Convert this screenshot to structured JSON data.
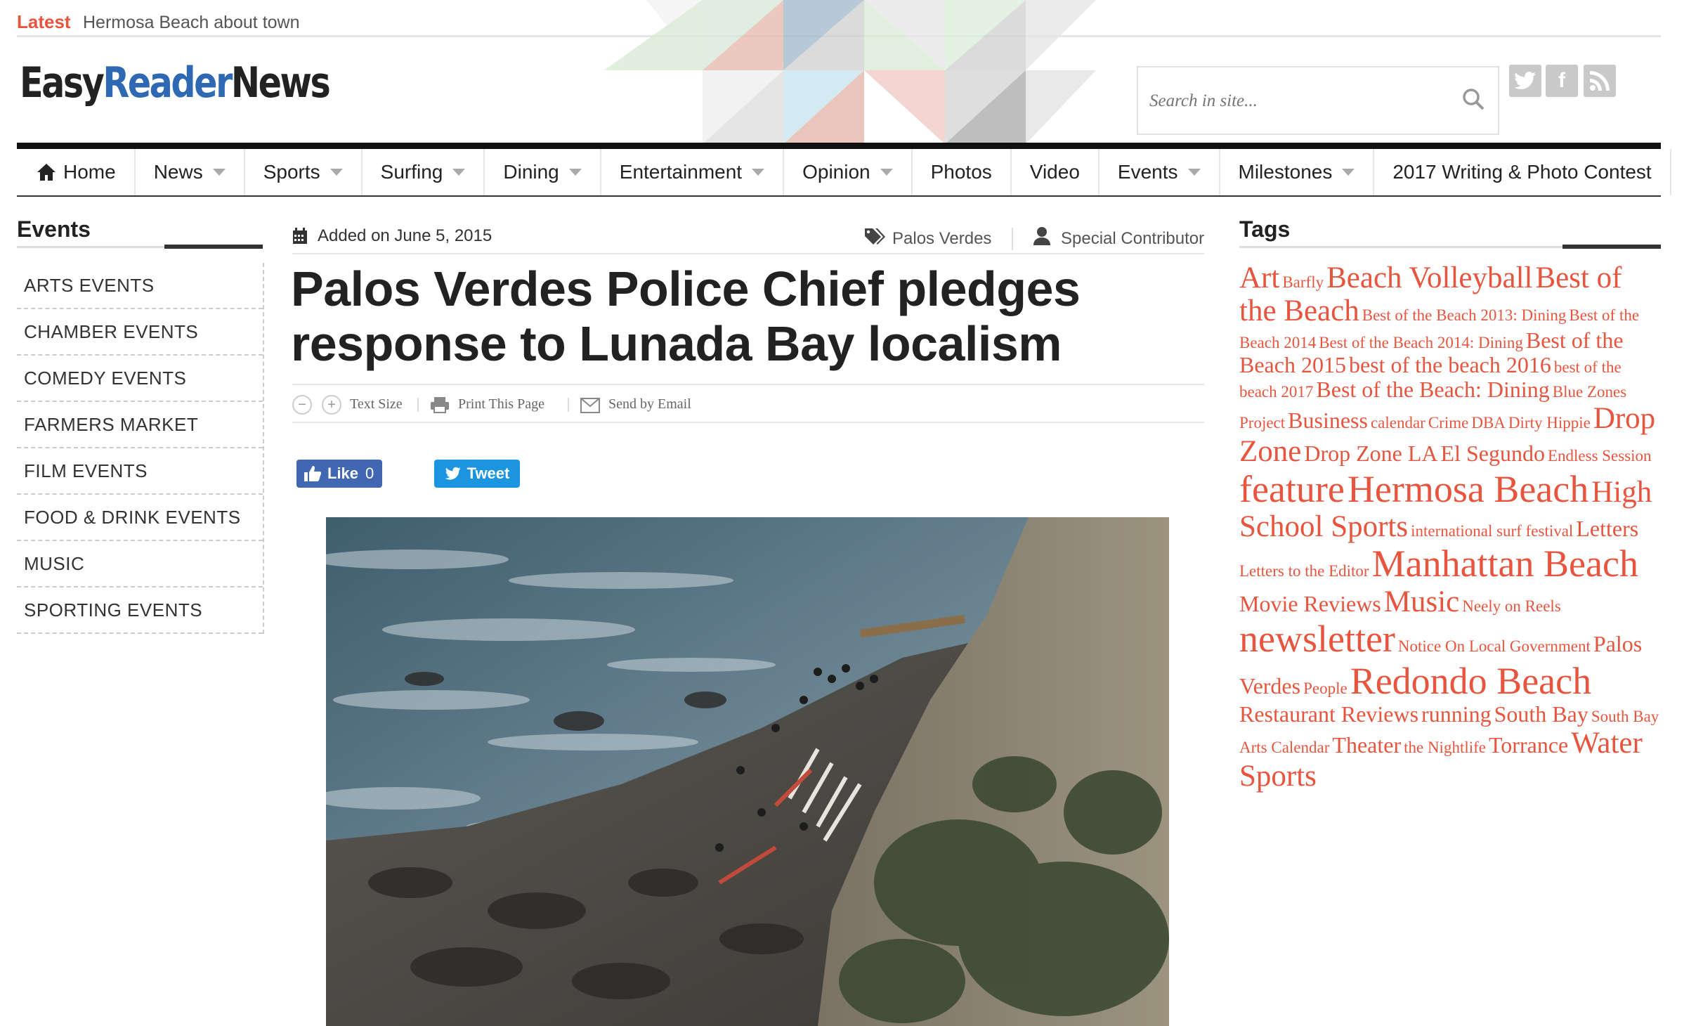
{
  "latest": {
    "label": "Latest",
    "headline": "Hermosa Beach about town"
  },
  "logo": {
    "part1": "Easy",
    "part2": "Reader",
    "part3": "News"
  },
  "search": {
    "placeholder": "Search in site..."
  },
  "social": [
    "twitter-icon",
    "facebook-icon",
    "rss-icon"
  ],
  "nav": {
    "items": [
      {
        "label": "Home",
        "icon": "home-icon",
        "dropdown": false
      },
      {
        "label": "News",
        "dropdown": true
      },
      {
        "label": "Sports",
        "dropdown": true
      },
      {
        "label": "Surfing",
        "dropdown": true
      },
      {
        "label": "Dining",
        "dropdown": true
      },
      {
        "label": "Entertainment",
        "dropdown": true
      },
      {
        "label": "Opinion",
        "dropdown": true
      },
      {
        "label": "Photos",
        "dropdown": false
      },
      {
        "label": "Video",
        "dropdown": false
      },
      {
        "label": "Events",
        "dropdown": true
      },
      {
        "label": "Milestones",
        "dropdown": true
      },
      {
        "label": "2017 Writing & Photo Contest",
        "dropdown": false
      }
    ]
  },
  "sidebar": {
    "title": "Events",
    "items": [
      "ARTS EVENTS",
      "CHAMBER EVENTS",
      "COMEDY EVENTS",
      "FARMERS MARKET",
      "FILM EVENTS",
      "FOOD & DRINK EVENTS",
      "MUSIC",
      "SPORTING EVENTS"
    ]
  },
  "article": {
    "date": "Added on June 5, 2015",
    "category": "Palos Verdes",
    "author": "Special Contributor",
    "headline": "Palos Verdes Police Chief pledges response to Lunada Bay localism",
    "tools": {
      "text_size": "Text Size",
      "print": "Print This Page",
      "email": "Send by Email"
    },
    "like": {
      "label": "Like",
      "count": "0"
    },
    "tweet": "Tweet"
  },
  "tags": {
    "title": "Tags",
    "items": [
      {
        "t": "Art",
        "s": 3
      },
      {
        "t": "Barfly",
        "s": 1
      },
      {
        "t": "Beach Volleyball",
        "s": 3
      },
      {
        "t": "Best of the Beach",
        "s": 3
      },
      {
        "t": "Best of the Beach 2013: Dining",
        "s": 1
      },
      {
        "t": "Best of the Beach 2014",
        "s": 1
      },
      {
        "t": "Best of the Beach 2014: Dining",
        "s": 1
      },
      {
        "t": "Best of the Beach 2015",
        "s": 2
      },
      {
        "t": "best of the beach 2016",
        "s": 2
      },
      {
        "t": "best of the beach 2017",
        "s": 1
      },
      {
        "t": "Best of the Beach: Dining",
        "s": 2
      },
      {
        "t": "Blue Zones Project",
        "s": 1
      },
      {
        "t": "Business",
        "s": 2
      },
      {
        "t": "calendar",
        "s": 1
      },
      {
        "t": "Crime",
        "s": 1
      },
      {
        "t": "DBA",
        "s": 1
      },
      {
        "t": "Dirty Hippie",
        "s": 1
      },
      {
        "t": "Drop Zone",
        "s": 3
      },
      {
        "t": "Drop Zone LA",
        "s": 2
      },
      {
        "t": "El Segundo",
        "s": 2
      },
      {
        "t": "Endless Session",
        "s": 1
      },
      {
        "t": "feature",
        "s": 4
      },
      {
        "t": "Hermosa Beach",
        "s": 4
      },
      {
        "t": "High School Sports",
        "s": 3
      },
      {
        "t": "international surf festival",
        "s": 1
      },
      {
        "t": "Letters",
        "s": 2
      },
      {
        "t": "Letters to the Editor",
        "s": 1
      },
      {
        "t": "Manhattan Beach",
        "s": 4
      },
      {
        "t": "Movie Reviews",
        "s": 2
      },
      {
        "t": "Music",
        "s": 3
      },
      {
        "t": "Neely on Reels",
        "s": 1
      },
      {
        "t": "newsletter",
        "s": 4
      },
      {
        "t": "Notice On Local Government",
        "s": 1
      },
      {
        "t": "Palos Verdes",
        "s": 2
      },
      {
        "t": "People",
        "s": 1
      },
      {
        "t": "Redondo Beach",
        "s": 4
      },
      {
        "t": "Restaurant Reviews",
        "s": 2
      },
      {
        "t": "running",
        "s": 2
      },
      {
        "t": "South Bay",
        "s": 2
      },
      {
        "t": "South Bay Arts Calendar",
        "s": 1
      },
      {
        "t": "Theater",
        "s": 2
      },
      {
        "t": "the Nightlife",
        "s": 1
      },
      {
        "t": "Torrance",
        "s": 2
      },
      {
        "t": "Water Sports",
        "s": 3
      }
    ]
  },
  "colors": {
    "accent": "#e8553f",
    "brand_blue": "#2f69b3",
    "facebook": "#4267b2",
    "twitter": "#1b95e0"
  }
}
